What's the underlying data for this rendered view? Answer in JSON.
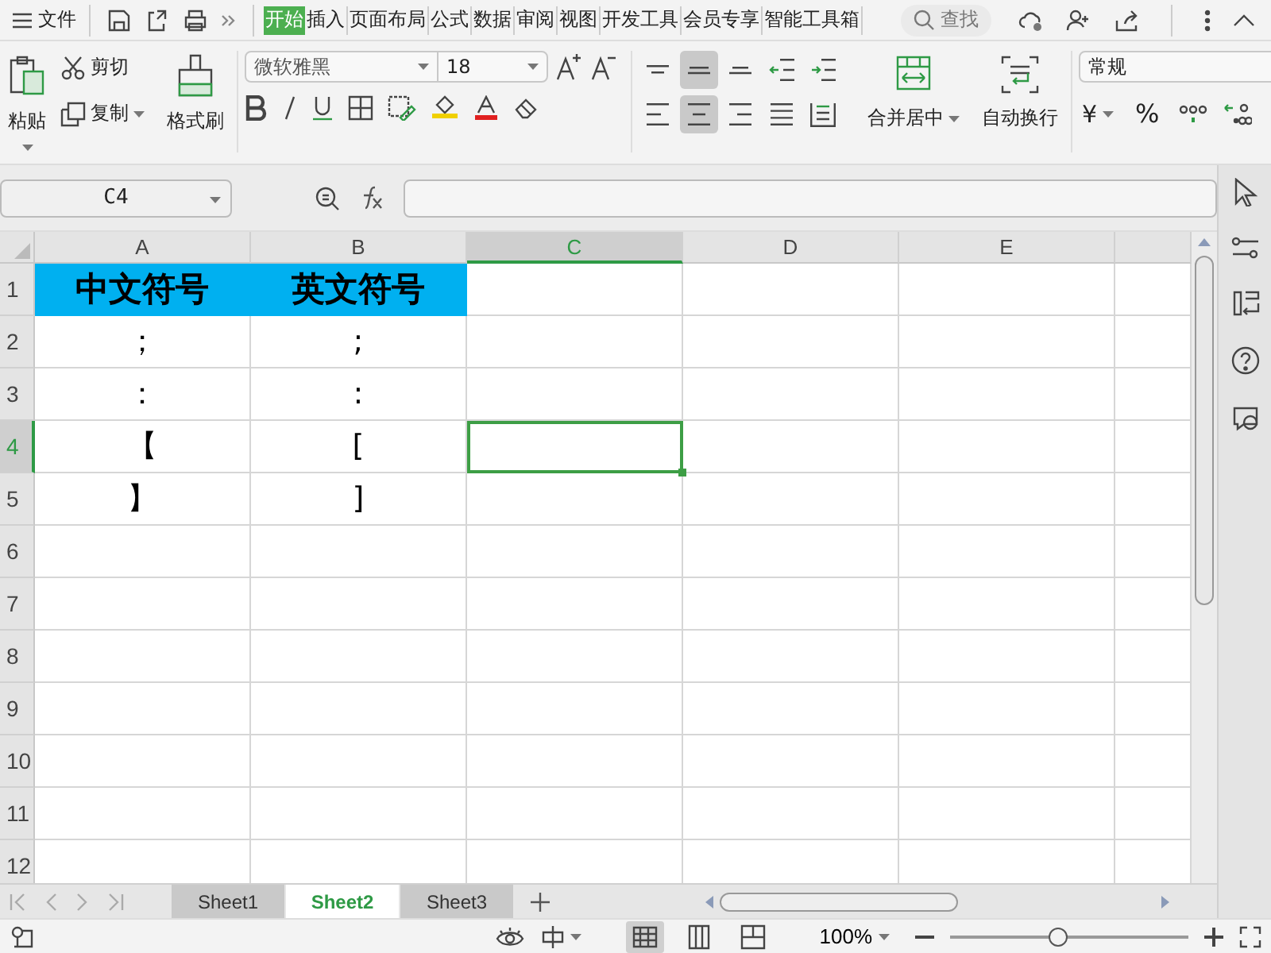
{
  "menu": {
    "file_label": "文件",
    "tabs": [
      {
        "label": "开始",
        "selected": true
      },
      {
        "label": "插入",
        "selected": false
      },
      {
        "label": "页面布局",
        "selected": false
      },
      {
        "label": "公式",
        "selected": false
      },
      {
        "label": "数据",
        "selected": false
      },
      {
        "label": "审阅",
        "selected": false
      },
      {
        "label": "视图",
        "selected": false
      },
      {
        "label": "开发工具",
        "selected": false
      },
      {
        "label": "会员专享",
        "selected": false
      },
      {
        "label": "智能工具箱",
        "selected": false
      }
    ],
    "search": "查找"
  },
  "ribbon": {
    "clipboard": {
      "paste": "粘贴",
      "cut": "剪切",
      "copy": "复制",
      "format_painter": "格式刷"
    },
    "font": {
      "name": "微软雅黑",
      "size": "18"
    },
    "alignment": {
      "buttons": [
        {
          "kind": "top",
          "selected": false
        },
        {
          "kind": "middle",
          "selected": true
        },
        {
          "kind": "bottom",
          "selected": false
        },
        {
          "kind": "outdent",
          "selected": false
        },
        {
          "kind": "indent",
          "selected": false
        },
        {
          "kind": "left",
          "selected": false
        },
        {
          "kind": "center",
          "selected": true
        },
        {
          "kind": "right",
          "selected": false
        },
        {
          "kind": "justify",
          "selected": false
        },
        {
          "kind": "distributed",
          "selected": false
        }
      ],
      "merge": "合并居中",
      "wrap": "自动换行"
    },
    "number": {
      "format": "常规",
      "currency": "¥",
      "percent": "%"
    }
  },
  "formula_bar": {
    "name_box": "C4"
  },
  "sheet": {
    "columns": [
      {
        "label": "A",
        "selected": false
      },
      {
        "label": "B",
        "selected": false
      },
      {
        "label": "C",
        "selected": true
      },
      {
        "label": "D",
        "selected": false
      },
      {
        "label": "E",
        "selected": false
      }
    ],
    "rows": [
      {
        "label": "1",
        "selected": false,
        "cells": [
          {
            "text": "中文符号",
            "filled": true
          },
          {
            "text": "英文符号",
            "filled": true
          }
        ]
      },
      {
        "label": "2",
        "selected": false,
        "cells": [
          {
            "text": "；",
            "filled": false
          },
          {
            "text": ";",
            "filled": false
          }
        ]
      },
      {
        "label": "3",
        "selected": false,
        "cells": [
          {
            "text": "：",
            "filled": false
          },
          {
            "text": ":",
            "filled": false
          }
        ]
      },
      {
        "label": "4",
        "selected": true,
        "cells": [
          {
            "text": "【",
            "filled": false
          },
          {
            "text": "[",
            "filled": false
          }
        ]
      },
      {
        "label": "5",
        "selected": false,
        "cells": [
          {
            "text": "】",
            "filled": false
          },
          {
            "text": "]",
            "filled": false
          }
        ]
      },
      {
        "label": "6",
        "selected": false,
        "cells": []
      },
      {
        "label": "7",
        "selected": false,
        "cells": []
      },
      {
        "label": "8",
        "selected": false,
        "cells": []
      },
      {
        "label": "9",
        "selected": false,
        "cells": []
      },
      {
        "label": "10",
        "selected": false,
        "cells": []
      },
      {
        "label": "11",
        "selected": false,
        "cells": []
      },
      {
        "label": "12",
        "selected": false,
        "cells": []
      }
    ]
  },
  "sheet_tabs": [
    {
      "label": "Sheet1",
      "selected": false
    },
    {
      "label": "Sheet2",
      "selected": true
    },
    {
      "label": "Sheet3",
      "selected": false
    }
  ],
  "status_bar": {
    "views": [
      {
        "kind": "normal",
        "selected": true
      },
      {
        "kind": "page",
        "selected": false
      },
      {
        "kind": "break",
        "selected": false
      }
    ],
    "zoom": "100%",
    "zoom_slider": {
      "level": 0.45
    }
  }
}
